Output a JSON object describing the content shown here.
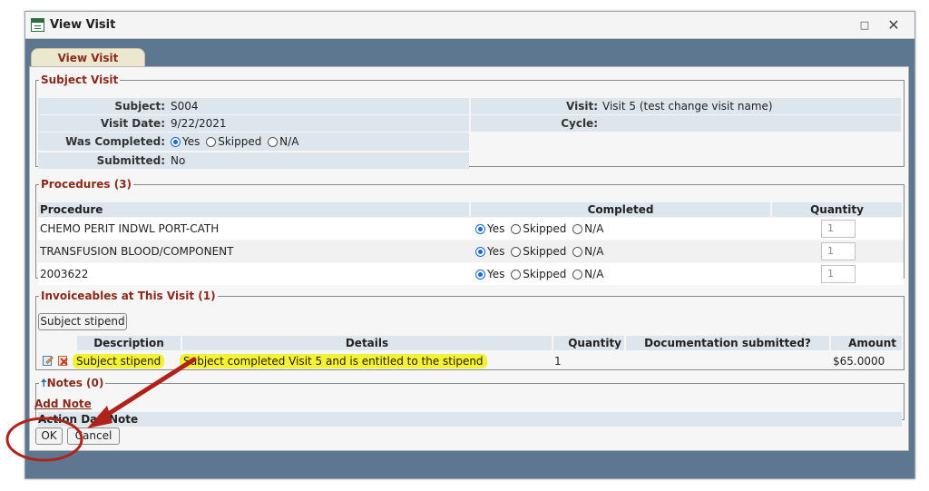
{
  "window": {
    "title": "View Visit",
    "maximize_glyph": "□",
    "close_glyph": "✕"
  },
  "tab": {
    "label": "View Visit"
  },
  "subject_visit": {
    "legend": "Subject Visit",
    "subject_label": "Subject:",
    "subject_value": "S004",
    "visit_label": "Visit:",
    "visit_value": "Visit 5 (test change visit name)",
    "visit_date_label": "Visit Date:",
    "visit_date_value": "9/22/2021",
    "cycle_label": "Cycle:",
    "cycle_value": "",
    "completed_label": "Was Completed:",
    "completed_options": [
      "Yes",
      "Skipped",
      "N/A"
    ],
    "completed_selected": "Yes",
    "submitted_label": "Submitted:",
    "submitted_value": "No"
  },
  "procedures": {
    "legend": "Procedures (3)",
    "headers": [
      "Procedure",
      "Completed",
      "Quantity"
    ],
    "options": [
      "Yes",
      "Skipped",
      "N/A"
    ],
    "rows": [
      {
        "name": "CHEMO PERIT INDWL PORT-CATH",
        "completed": "Yes",
        "quantity": "1"
      },
      {
        "name": "TRANSFUSION BLOOD/COMPONENT",
        "completed": "Yes",
        "quantity": "1"
      },
      {
        "name": "2003622",
        "completed": "Yes",
        "quantity": "1"
      }
    ]
  },
  "invoiceables": {
    "legend": "Invoiceables at This Visit (1)",
    "add_button": "Subject stipend",
    "headers": [
      "Description",
      "Details",
      "Quantity",
      "Documentation submitted?",
      "Amount"
    ],
    "rows": [
      {
        "description": "Subject stipend",
        "details": "Subject completed Visit 5 and is entitled to the stipend",
        "quantity": "1",
        "documentation": "",
        "amount": "$65.0000"
      }
    ]
  },
  "notes": {
    "legend": "Notes (0)",
    "add_link": "Add Note",
    "headers": [
      "Action Date",
      "Note"
    ]
  },
  "footer": {
    "ok_label": "OK",
    "cancel_label": "Cancel"
  },
  "colors": {
    "accent": "#8b2a1c",
    "header_bg": "#dde6ed",
    "frame": "#5d7791",
    "highlight": "#f4f235",
    "annotation": "#b0231b",
    "radio_selected": "#1a66d4"
  },
  "icons": [
    "window-app-icon",
    "maximize-icon",
    "close-icon",
    "edit-icon",
    "delete-icon",
    "collapse-arrow-icon"
  ]
}
